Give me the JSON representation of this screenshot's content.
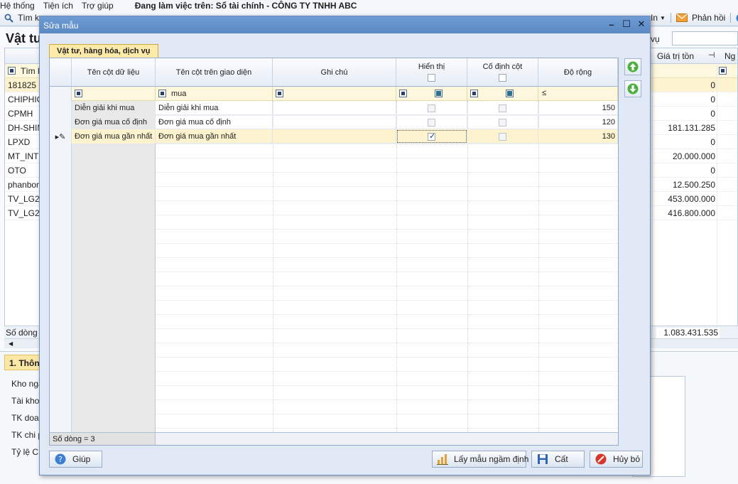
{
  "app": {
    "menu": [
      "Hệ thống",
      "Tiện ích",
      "Trợ giúp"
    ],
    "working_on": "Đang làm việc trên: Sổ tài chính - CÔNG TY TNHH ABC",
    "toolbar_search": "Tìm k",
    "toolbar_in": "In",
    "toolbar_feedback": "Phản hồi"
  },
  "background": {
    "title": "Vật tư",
    "search_suffix": "vụ",
    "grid_header_value": "Giá trị tồn",
    "grid_header_ng": "Ng",
    "filter_label": "Tìm k",
    "rows": [
      {
        "code": "181825",
        "value": "0"
      },
      {
        "code": "CHIPHIC",
        "value": "0"
      },
      {
        "code": "CPMH",
        "value": "0"
      },
      {
        "code": "DH-SHIM",
        "value": "181.131.285"
      },
      {
        "code": "LPXD",
        "value": "0"
      },
      {
        "code": "MT_INTE",
        "value": "20.000.000"
      },
      {
        "code": "OTO",
        "value": "0"
      },
      {
        "code": "phanbon",
        "value": "12.500.250"
      },
      {
        "code": "TV_LG21",
        "value": "453.000.000"
      },
      {
        "code": "TV_LG29",
        "value": "416.800.000"
      }
    ],
    "footer_count": "Số dòng =",
    "footer_total": "1.083.431.535",
    "info_tab": "1. Thôn",
    "info_fields": [
      "Kho ngầ",
      "Tài khoả",
      "TK doan",
      "TK chi p",
      "Tỷ lệ CK"
    ]
  },
  "dialog": {
    "title": "Sửa mẫu",
    "tab": "Vật tư, hàng hóa, dịch vụ",
    "columns": [
      "Tên cột dữ liệu",
      "Tên cột trên giao diện",
      "Ghi chú",
      "Hiển thị",
      "Cố định cột",
      "Độ rộng"
    ],
    "filter": {
      "display_name": "mua",
      "width_op": "≤"
    },
    "rows": [
      {
        "data_name": "Diễn giải khi mua",
        "display_name": "Diễn giải khi mua",
        "note": "",
        "visible": false,
        "fixed": false,
        "width": "150"
      },
      {
        "data_name": "Đơn giá mua cố định",
        "display_name": "Đơn giá mua cố định",
        "note": "",
        "visible": false,
        "fixed": false,
        "width": "120"
      },
      {
        "data_name": "Đơn giá mua gần nhất",
        "display_name": "Đơn giá mua gần nhất",
        "note": "",
        "visible": true,
        "fixed": false,
        "width": "130"
      }
    ],
    "row_count": "Số dòng = 3",
    "buttons": {
      "help": "Giúp",
      "default_template": "Lấy mẫu ngầm định",
      "save": "Cất",
      "cancel": "Hủy bỏ"
    }
  }
}
